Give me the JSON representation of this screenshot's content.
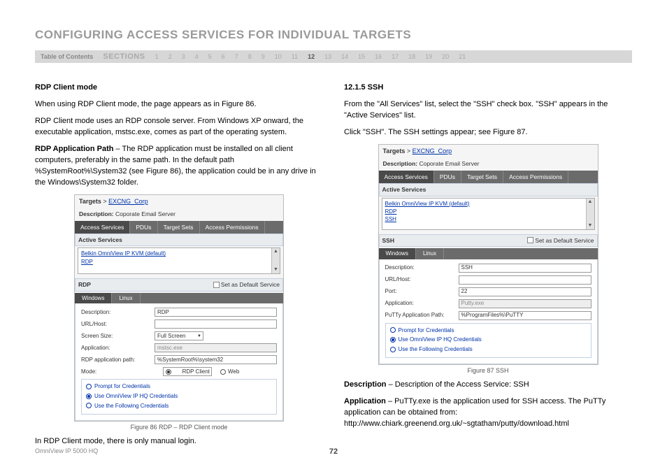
{
  "header": {
    "title": "CONFIGURING ACCESS SERVICES FOR INDIVIDUAL TARGETS",
    "toc": "Table of Contents",
    "sections": "SECTIONS",
    "nums": [
      "1",
      "2",
      "3",
      "4",
      "5",
      "6",
      "7",
      "8",
      "9",
      "10",
      "11",
      "12",
      "13",
      "14",
      "15",
      "16",
      "17",
      "18",
      "19",
      "20",
      "21"
    ],
    "active": "12"
  },
  "left": {
    "h1": "RDP Client mode",
    "p1": "When using RDP Client mode, the page appears as in Figure 86.",
    "p2": "RDP Client mode uses an RDP console server. From Windows XP onward, the executable application, mstsc.exe, comes as part of the operating system.",
    "p3a": "RDP Application Path",
    "p3b": " – The RDP application must be installed on all client computers, preferably in the same path. In the default path %SystemRoot%\\System32 (see Figure 86), the application could be in any drive in the Windows\\System32 folder.",
    "p4": "In RDP Client mode, there is only manual login.",
    "fig86cap": "Figure 86 RDP – RDP Client mode"
  },
  "right": {
    "h1": "12.1.5 SSH",
    "p1": "From the \"All Services\" list, select the \"SSH\" check box. \"SSH\" appears in the \"Active Services\" list.",
    "p2": "Click \"SSH\". The SSH settings appear; see Figure 87.",
    "fig87cap": "Figure 87 SSH",
    "d1a": "Description",
    "d1b": " – Description of the Access Service: SSH",
    "d2a": "Application",
    "d2b": " – PuTTy.exe is the application used for SSH access. The PuTTy application can be obtained from: http://www.chiark.greenend.org.uk/~sgtatham/putty/download.html"
  },
  "fig86": {
    "breadcrumb_label": "Targets",
    "breadcrumb_sep": " > ",
    "breadcrumb_target": "EXCNG_Corp",
    "desc_label": "Description:",
    "desc_value": "Coporate Email Server",
    "tabs": [
      "Access Services",
      "PDUs",
      "Target Sets",
      "Access Permissions"
    ],
    "active_services": "Active Services",
    "items": [
      "Belkin OmniView IP KVM (default)",
      "RDP"
    ],
    "svc_name": "RDP",
    "set_default": "Set as Default Service",
    "subtabs": [
      "Windows",
      "Linux"
    ],
    "rows": {
      "desc_l": "Description:",
      "desc_v": "RDP",
      "url_l": "URL/Host:",
      "url_v": "",
      "screen_l": "Screen Size:",
      "screen_v": "Full Screen",
      "app_l": "Application:",
      "app_v": "mstsc.exe",
      "path_l": "RDP application path:",
      "path_v": "%SystemRoot%\\system32",
      "mode_l": "Mode:",
      "mode_a": "RDP Client",
      "mode_b": "Web"
    },
    "creds": [
      "Prompt for Credentials",
      "Use OmniView IP HQ Credentials",
      "Use the Following Credentials"
    ]
  },
  "fig87": {
    "breadcrumb_label": "Targets",
    "breadcrumb_sep": " > ",
    "breadcrumb_target": "EXCNG_Corp",
    "desc_label": "Description:",
    "desc_value": "Coporate Email Server",
    "tabs": [
      "Access Services",
      "PDUs",
      "Target Sets",
      "Access Permissions"
    ],
    "active_services": "Active Services",
    "items": [
      "Belkin OmniView IP KVM (default)",
      "RDP",
      "SSH"
    ],
    "svc_name": "SSH",
    "set_default": "Set as Default Service",
    "subtabs": [
      "Windows",
      "Linux"
    ],
    "rows": {
      "desc_l": "Description:",
      "desc_v": "SSH",
      "url_l": "URL/Host:",
      "url_v": "",
      "port_l": "Port:",
      "port_v": "22",
      "app_l": "Application:",
      "app_v": "Putty.exe",
      "path_l": "PuTTy Application Path:",
      "path_v": "%ProgramFiles%\\PuTTY"
    },
    "creds": [
      "Prompt for Credentials",
      "Use OmniView IP HQ Credentials",
      "Use the Following Credentials"
    ]
  },
  "footer": {
    "product": "OmniView IP 5000 HQ",
    "page": "72"
  }
}
